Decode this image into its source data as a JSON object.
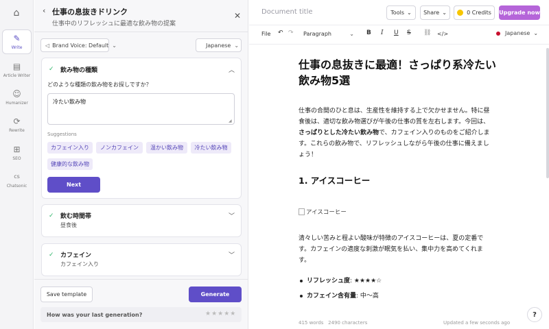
{
  "rail": {
    "items": [
      {
        "label": "Write",
        "icon": "✎"
      },
      {
        "label": "Article Writer",
        "icon": "▤"
      },
      {
        "label": "Humanizer",
        "icon": "☺"
      },
      {
        "label": "Rewrite",
        "icon": "⟳"
      },
      {
        "label": "SEO",
        "icon": "⊞"
      },
      {
        "label": "Chatsonic",
        "icon": "cs"
      }
    ]
  },
  "panel": {
    "title": "仕事の息抜きドリンク",
    "subtitle": "仕事中のリフレッシュに最適な飲み物の提案",
    "brand_voice": "Brand Voice: Default",
    "language": "Japanese",
    "steps": [
      {
        "title": "飲み物の種類",
        "question": "どのような種類の飲み物をお探しですか？",
        "answer": "冷たい飲み物",
        "suggestions_label": "Suggestions",
        "suggestions": [
          "カフェイン入り",
          "ノンカフェイン",
          "温かい飲み物",
          "冷たい飲み物",
          "健康的な飲み物"
        ],
        "next_label": "Next"
      },
      {
        "title": "飲む時間帯",
        "value": "昼食後"
      },
      {
        "title": "カフェイン",
        "value": "カフェイン入り"
      }
    ],
    "save_template": "Save template",
    "generate": "Generate",
    "feedback_question": "How was your last generation?"
  },
  "editor": {
    "doc_title_placeholder": "Document title",
    "tools": "Tools",
    "share": "Share",
    "credits": "0 Credits",
    "upgrade": "Upgrade now",
    "toolbar": {
      "file": "File",
      "paragraph": "Paragraph",
      "language": "Japanese"
    },
    "heading": "仕事の息抜きに最適！さっぱり系冷たい飲み物5選",
    "intro_part1": "仕事の合間のひと息は、生産性を維持する上で欠かせません。特に昼食後は、適切な飲み物選びが午後の仕事の質を左右します。今回は、",
    "intro_bold": "さっぱりとした冷たい飲み物",
    "intro_part2": "で、カフェイン入りのものをご紹介します。これらの飲み物で、リフレッシュしながら午後の仕事に備えましょう！",
    "section1_title": "1. アイスコーヒー",
    "section1_image_alt": "アイスコーヒー",
    "section1_body": "清々しい苦みと程よい酸味が特徴のアイスコーヒーは、夏の定番です。カフェインの適度な刺激が眠気を払い、集中力を高めてくれます。",
    "bullets": [
      {
        "label": "リフレッシュ度",
        "value": ": ★★★★☆"
      },
      {
        "label": "カフェイン含有量",
        "value": ": 中〜高"
      }
    ],
    "word_count": "415 words",
    "char_count": "2490 characters",
    "updated": "Updated a few seconds ago",
    "help": "?"
  },
  "colors": {
    "accent": "#5f4ec8",
    "upgrade": "#b565d9",
    "check": "#2fb56a",
    "chip_bg": "#eeeaf9"
  }
}
